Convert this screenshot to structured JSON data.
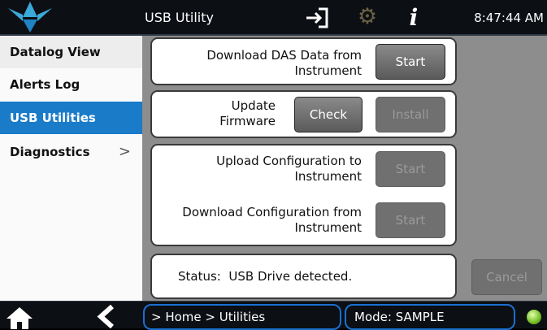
{
  "header": {
    "title": "USB Utility",
    "clock": "8:47:44 AM",
    "icons": {
      "logo": "logo-icon",
      "login": "login-icon",
      "settings": "gear-icon",
      "info": "info-icon"
    },
    "info_glyph": "i"
  },
  "sidebar": {
    "items": [
      {
        "label": "Datalog View"
      },
      {
        "label": "Alerts Log"
      },
      {
        "label": "USB Utilities",
        "selected": true
      },
      {
        "label": "Diagnostics",
        "chevron": ">"
      }
    ]
  },
  "main": {
    "download_das": {
      "label": "Download DAS Data from Instrument",
      "button": "Start"
    },
    "firmware": {
      "label": "Update Firmware",
      "check_button": "Check",
      "install_button": "Install"
    },
    "config": {
      "upload_label": "Upload Configuration to Instrument",
      "upload_button": "Start",
      "download_label": "Download Configuration from Instrument",
      "download_button": "Start"
    },
    "status": {
      "text": "Status:  USB Drive detected."
    },
    "cancel_button": "Cancel"
  },
  "footer": {
    "breadcrumb": "> Home > Utilities",
    "mode": "Mode: SAMPLE",
    "icons": {
      "home": "home-icon",
      "back": "back-icon",
      "status_led": "status-led-icon"
    }
  },
  "colors": {
    "accent": "#1a7bc9",
    "status_led": "#7bc32a",
    "gear": "#6b6243"
  }
}
